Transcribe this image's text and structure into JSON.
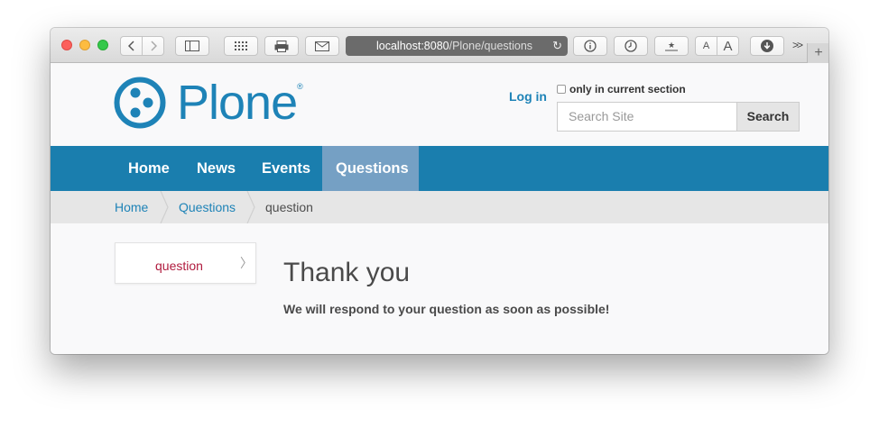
{
  "browser": {
    "url_host": "localhost:8080",
    "url_path": "/Plone/questions"
  },
  "site": {
    "logo_text": "Plone",
    "logo_mark": "®",
    "login_label": "Log in",
    "search_scope_label": "only in current section",
    "search_placeholder": "Search Site",
    "search_button": "Search"
  },
  "nav": {
    "items": [
      {
        "label": "Home"
      },
      {
        "label": "News"
      },
      {
        "label": "Events"
      },
      {
        "label": "Questions",
        "active": true
      }
    ]
  },
  "breadcrumb": {
    "items": [
      {
        "label": "Home"
      },
      {
        "label": "Questions"
      },
      {
        "label": "question"
      }
    ]
  },
  "portlet": {
    "item_label": "question"
  },
  "main": {
    "title": "Thank you",
    "message": "We will respond to your question as soon as possible!"
  },
  "colors": {
    "brand": "#1e83b7",
    "nav_bg": "#1a7eae",
    "nav_active": "#75a0c4",
    "portlet_link": "#b01b3e"
  }
}
